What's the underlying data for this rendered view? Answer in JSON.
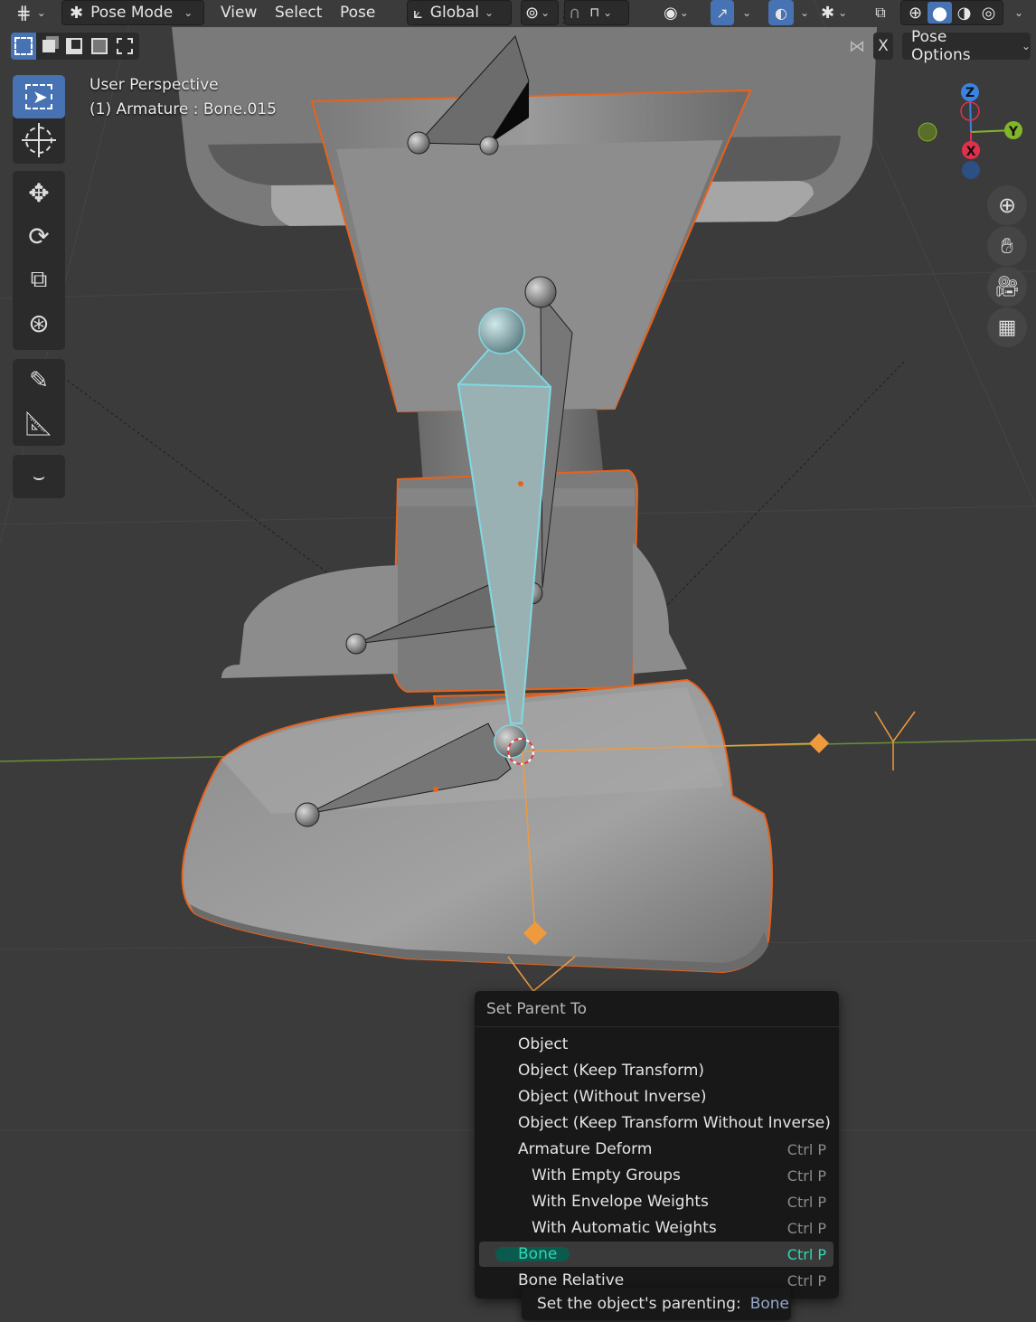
{
  "header": {
    "mode_label": "Pose Mode",
    "menus": [
      "View",
      "Select",
      "Pose"
    ],
    "orientation_label": "Global",
    "pose_options_label": "Pose Options",
    "x_mirror_label": "X"
  },
  "overlay_text": {
    "view_name": "User Perspective",
    "object_info": "(1) Armature : Bone.015"
  },
  "gizmo": {
    "z_label": "Z",
    "y_label": "Y",
    "x_label": "X"
  },
  "toolbar": {
    "tools": [
      "select-box",
      "cursor",
      "move",
      "rotate",
      "scale",
      "transform",
      "annotate",
      "measure",
      "bone-envelope"
    ]
  },
  "menu": {
    "title": "Set Parent To",
    "items": [
      {
        "label": "Object",
        "shortcut": ""
      },
      {
        "label": "Object (Keep Transform)",
        "shortcut": ""
      },
      {
        "label": "Object (Without Inverse)",
        "shortcut": ""
      },
      {
        "label": "Object (Keep Transform Without Inverse)",
        "shortcut": ""
      },
      {
        "label": "Armature Deform",
        "shortcut": "Ctrl P"
      },
      {
        "label": "With Empty Groups",
        "shortcut": "Ctrl P"
      },
      {
        "label": "With Envelope Weights",
        "shortcut": "Ctrl P"
      },
      {
        "label": "With Automatic Weights",
        "shortcut": "Ctrl P"
      },
      {
        "label": "Bone",
        "shortcut": "Ctrl P"
      },
      {
        "label": "Bone Relative",
        "shortcut": "Ctrl P"
      }
    ]
  },
  "tooltip": {
    "text": "Set the object's parenting:",
    "value": "Bone"
  },
  "colors": {
    "background": "#3a3a3a",
    "selection_outline": "#e8621b",
    "active_bone": "#7fd8e0",
    "accent": "#4772b3",
    "highlight_text": "#2fd8b4"
  }
}
